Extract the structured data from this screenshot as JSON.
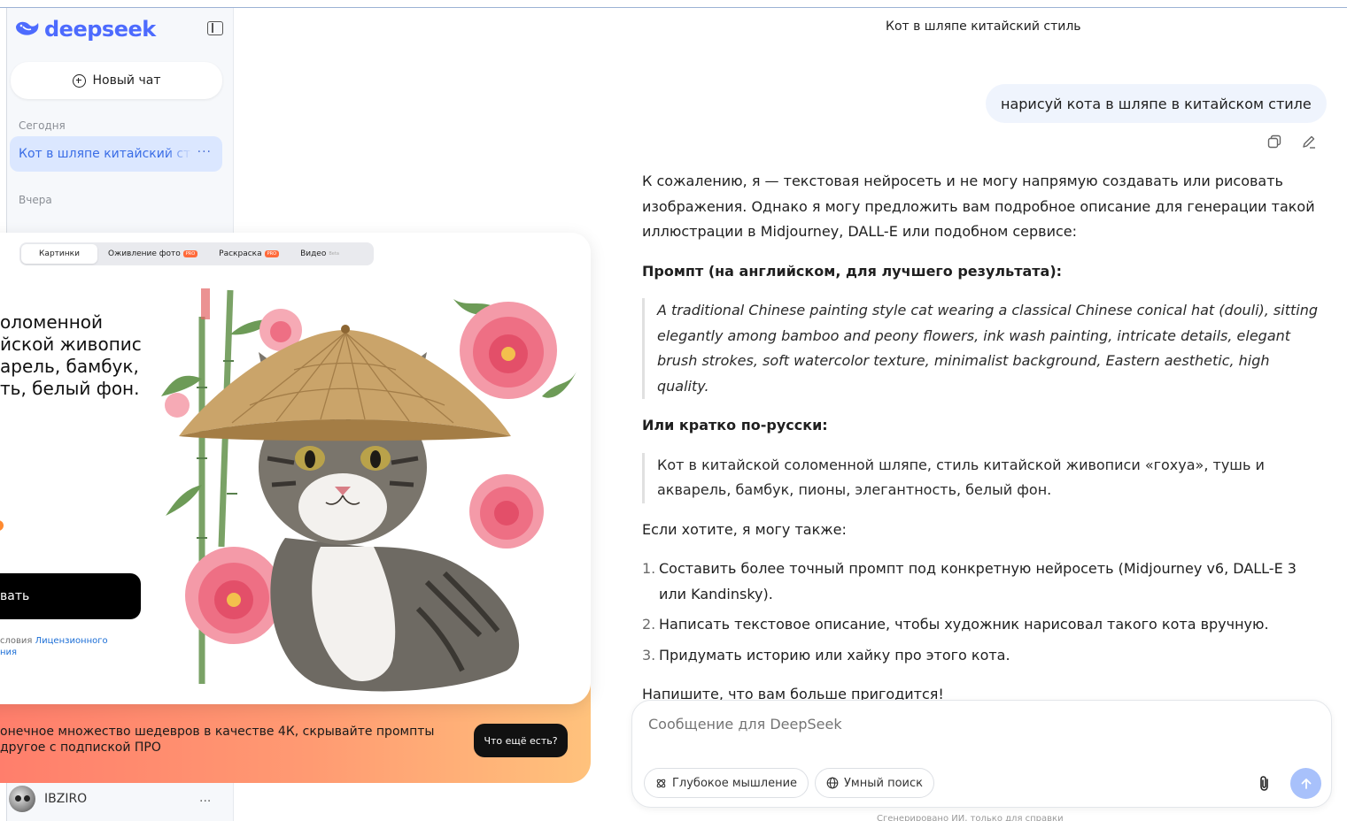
{
  "sidebar": {
    "logo_text": "deepseek",
    "new_chat_label": "Новый чат",
    "section_today": "Сегодня",
    "active_chat": "Кот в шляпе китайский стиль",
    "section_yesterday": "Вчера",
    "user_name": "IBZIRO",
    "more_label": "···"
  },
  "ad": {
    "tabs": [
      {
        "label": "Картинки",
        "badge": ""
      },
      {
        "label": "Оживление фото",
        "badge": "PRO"
      },
      {
        "label": "Раскраска",
        "badge": "PRO"
      },
      {
        "label": "Видео",
        "badge": "Beta"
      }
    ],
    "description_lines": [
      "оломенной",
      "йской живописи",
      "арель, бамбук,",
      "ть, белый фон."
    ],
    "button_label": "вать",
    "legal_prefix": "словия ",
    "legal_link": "Лицензионного",
    "legal_suffix": "ния",
    "promo_line1": "онечное множество шедевров в качестве 4К, скрывайте промпты",
    "promo_line2": " другое с подпиской ПРО",
    "more_button": "Что ещё есть?"
  },
  "chat": {
    "title": "Кот в шляпе китайский стиль",
    "user_message": "нарисуй кота в шляпе в китайском стиле",
    "intro": "К сожалению, я — текстовая нейросеть и не могу напрямую создавать или рисовать изображения. Однако я могу предложить вам подробное описание для генерации такой иллюстрации в Midjourney, DALL-E или подобном сервисе:",
    "prompt_heading": "Промпт (на английском, для лучшего результата):",
    "prompt_en": "A traditional Chinese painting style cat wearing a classical Chinese conical hat (douli), sitting elegantly among bamboo and peony flowers, ink wash painting, intricate details, elegant brush strokes, soft watercolor texture, minimalist background, Eastern aesthetic, high quality.",
    "short_heading": "Или кратко по-русски:",
    "prompt_ru": "Кот в китайской соломенной шляпе, стиль китайской живописи «гохуа», тушь и акварель, бамбук, пионы, элегантность, белый фон.",
    "offer_intro": "Если хотите, я могу также:",
    "options": [
      {
        "num": "1.",
        "text": "Составить более точный промпт под конкретную нейросеть (Midjourney v6, DALL-E 3 или Kandinsky)."
      },
      {
        "num": "2.",
        "text": "Написать текстовое описание, чтобы художник нарисовал такого кота вручную."
      },
      {
        "num": "3.",
        "text": "Придумать историю или хайку про этого кота."
      }
    ],
    "closing": "Напишите, что вам больше пригодится!"
  },
  "input": {
    "placeholder": "Сообщение для DeepSeek",
    "deep_think_label": "Глубокое мышление",
    "search_label": "Умный поиск",
    "footer_note": "Сгенерировано ИИ, только для справки"
  },
  "colors": {
    "brand": "#4d6bfe",
    "active_chat_bg": "#dbe7ff",
    "send_button": "#a8c1fb"
  }
}
